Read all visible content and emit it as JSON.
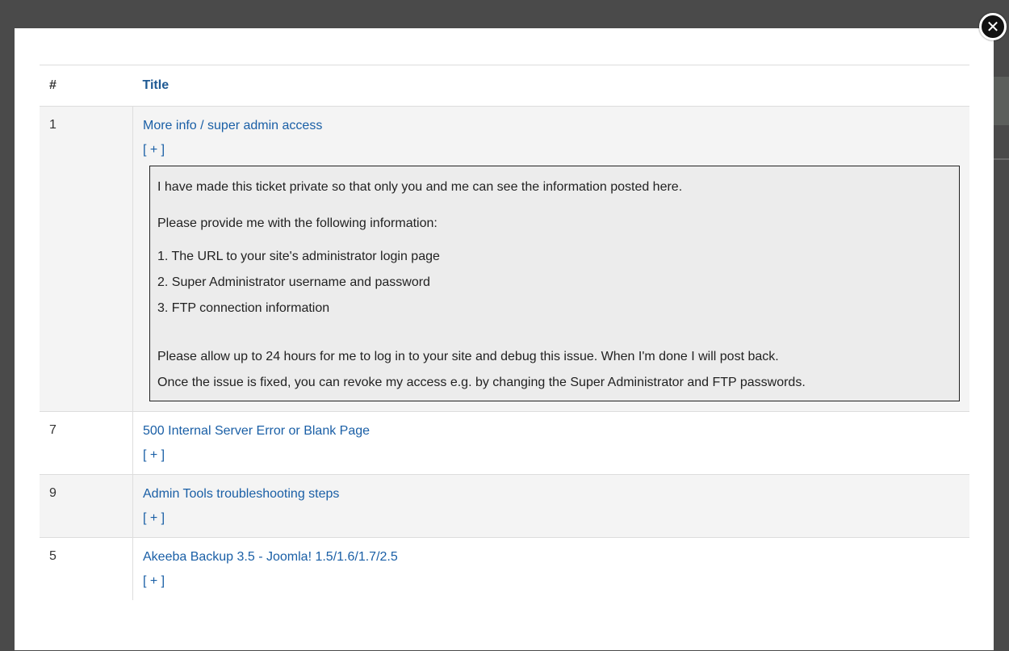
{
  "table": {
    "headers": {
      "num": "#",
      "title": "Title"
    },
    "rows": [
      {
        "num": "1",
        "title": "More info / super admin access",
        "toggle": "[ + ]",
        "expanded": true,
        "details": {
          "intro": "I have made this ticket private so that only you and me can see the information posted here.",
          "request": "Please provide me with the following information:",
          "items": [
            "1.  The URL to your site's administrator login page",
            "2.  Super Administrator username and password",
            "3.  FTP connection information"
          ],
          "closing_1": "Please allow up to 24 hours for me to log in to your site and debug this issue. When I'm done I will post back.",
          "closing_2": "Once the issue is fixed, you can revoke my access e.g. by changing the Super Administrator and FTP passwords."
        }
      },
      {
        "num": "7",
        "title": "500 Internal Server Error or Blank Page",
        "toggle": "[ + ]"
      },
      {
        "num": "9",
        "title": "Admin Tools troubleshooting steps",
        "toggle": "[ + ]"
      },
      {
        "num": "5",
        "title": "Akeeba Backup 3.5 - Joomla! 1.5/1.6/1.7/2.5",
        "toggle": "[ + ]"
      }
    ]
  },
  "close": {
    "icon": "close-icon",
    "glyph": "✕"
  },
  "colors": {
    "link": "#1a5fa6",
    "header_link": "#1f5a94",
    "stripe": "#f4f4f4",
    "details_bg": "#ececec",
    "overlay": "#4a4a4a"
  }
}
